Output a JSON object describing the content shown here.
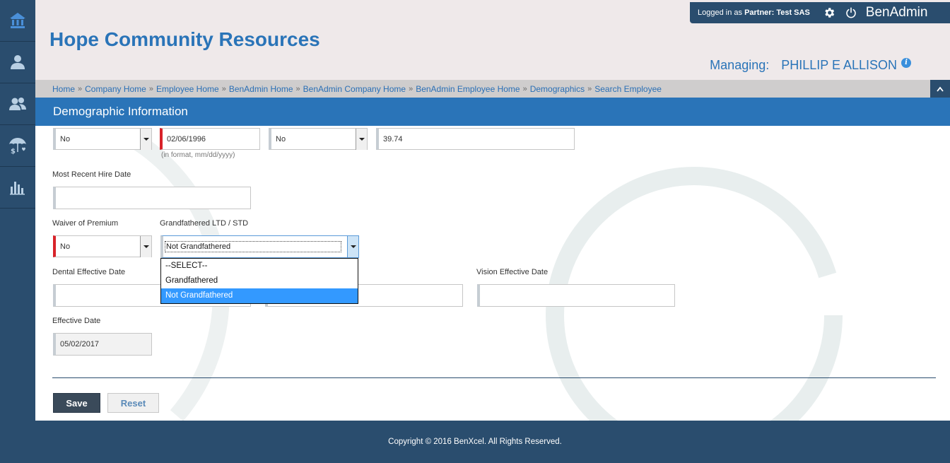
{
  "nav": {
    "items": [
      {
        "icon": "home-icon"
      },
      {
        "icon": "user-icon"
      },
      {
        "icon": "users-icon"
      },
      {
        "icon": "benefits-umbrella-icon"
      },
      {
        "icon": "bar-chart-icon"
      }
    ]
  },
  "header": {
    "title": "Hope Community Resources",
    "login_prefix": "Logged in as",
    "login_role": "Partner:",
    "login_user": "Test SAS",
    "brand": "BenAdmin",
    "managing_label": "Managing:",
    "managing_name": "PHILLIP E ALLISON",
    "info_glyph": "i"
  },
  "breadcrumb": [
    "Home",
    "Company Home",
    "Employee Home",
    "BenAdmin Home",
    "BenAdmin Company Home",
    "BenAdmin Employee Home",
    "Demographics",
    "Search Employee"
  ],
  "breadcrumb_sep": "»",
  "section": {
    "title": "Demographic Information"
  },
  "form": {
    "row1": {
      "select1_value": "No",
      "date_value": "02/06/1996",
      "date_hint": "(in format, mm/dd/yyyy)",
      "select2_value": "No",
      "number_value": "39.74"
    },
    "most_recent_hire_date": {
      "label": "Most Recent Hire Date",
      "value": ""
    },
    "waiver_of_premium": {
      "label": "Waiver of Premium",
      "value": "No"
    },
    "grandfathered": {
      "label": "Grandfathered LTD / STD",
      "value": "Not Grandfathered",
      "options": [
        "--SELECT--",
        "Grandfathered",
        "Not Grandfathered"
      ]
    },
    "dental_effective_date": {
      "label": "Dental Effective Date",
      "value": ""
    },
    "medical_effective_date": {
      "value": ""
    },
    "vision_effective_date": {
      "label": "Vision Effective Date",
      "value": ""
    },
    "effective_date": {
      "label": "Effective Date",
      "value": "05/02/2017"
    }
  },
  "buttons": {
    "save": "Save",
    "reset": "Reset"
  },
  "footer": {
    "copyright": "Copyright © 2016 BenXcel. All Rights Reserved."
  },
  "colors": {
    "nav_bg": "#2a4d6e",
    "accent_blue": "#2a74b8",
    "required_red": "#d8232a",
    "dropdown_selected": "#3399ff"
  }
}
